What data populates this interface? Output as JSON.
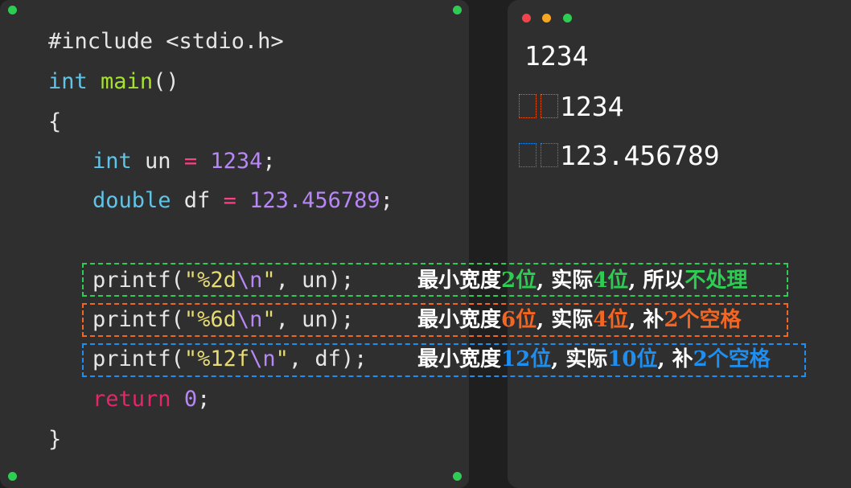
{
  "editor": {
    "code": {
      "include": "#include <stdio.h>",
      "kw_int": "int",
      "fn_main": "main",
      "parens": "()",
      "open_brace": "{",
      "decl1_type": "int",
      "decl1_rest": " un ",
      "decl1_eq": "=",
      "decl1_val": "1234",
      "decl1_semi": ";",
      "decl2_type": "double",
      "decl2_rest": " df ",
      "decl2_eq": "=",
      "decl2_val": "123.456789",
      "decl2_semi": ";",
      "printf_name": "printf",
      "p1_open": "(",
      "p1_str_a": "\"%2d",
      "p1_esc": "\\n",
      "p1_str_b": "\"",
      "p1_rest": ", un);",
      "p2_str_a": "\"%6d",
      "p2_esc": "\\n",
      "p2_str_b": "\"",
      "p2_rest": ", un);",
      "p3_str_a": "\"%12f",
      "p3_esc": "\\n",
      "p3_str_b": "\"",
      "p3_rest": ", df);",
      "kw_return": "return",
      "return_val": "0",
      "return_semi": ";",
      "close_brace": "}"
    }
  },
  "annotations": [
    {
      "color": "#2ecc52",
      "text_a": "最小宽度",
      "hl1": "2位",
      "text_b": ", 实际",
      "hl2": "4位",
      "text_c": ", 所以",
      "hl3": "不处理"
    },
    {
      "color": "#f26522",
      "text_a": "最小宽度",
      "hl1": "6位",
      "text_b": ", 实际",
      "hl2": "4位",
      "text_c": ", 补",
      "hl3": "2个空格"
    },
    {
      "color": "#1f8ef1",
      "text_a": "最小宽度",
      "hl1": "12位",
      "text_b": ", 实际",
      "hl2": "10位",
      "text_c": ", 补",
      "hl3": "2个空格"
    }
  ],
  "terminal": {
    "window_buttons": [
      "#f0434a",
      "#f5a623",
      "#2ecc52"
    ],
    "output": [
      "1234",
      "1234",
      "123.456789"
    ]
  },
  "colors": {
    "background": "#2f2f2f",
    "keyword": "#5fc4e8",
    "function": "#a6e22e",
    "operator": "#ff3f86",
    "number": "#b787f5",
    "string": "#e7db74",
    "green": "#2ecc52",
    "orange": "#f26522",
    "blue": "#1f8ef1"
  }
}
